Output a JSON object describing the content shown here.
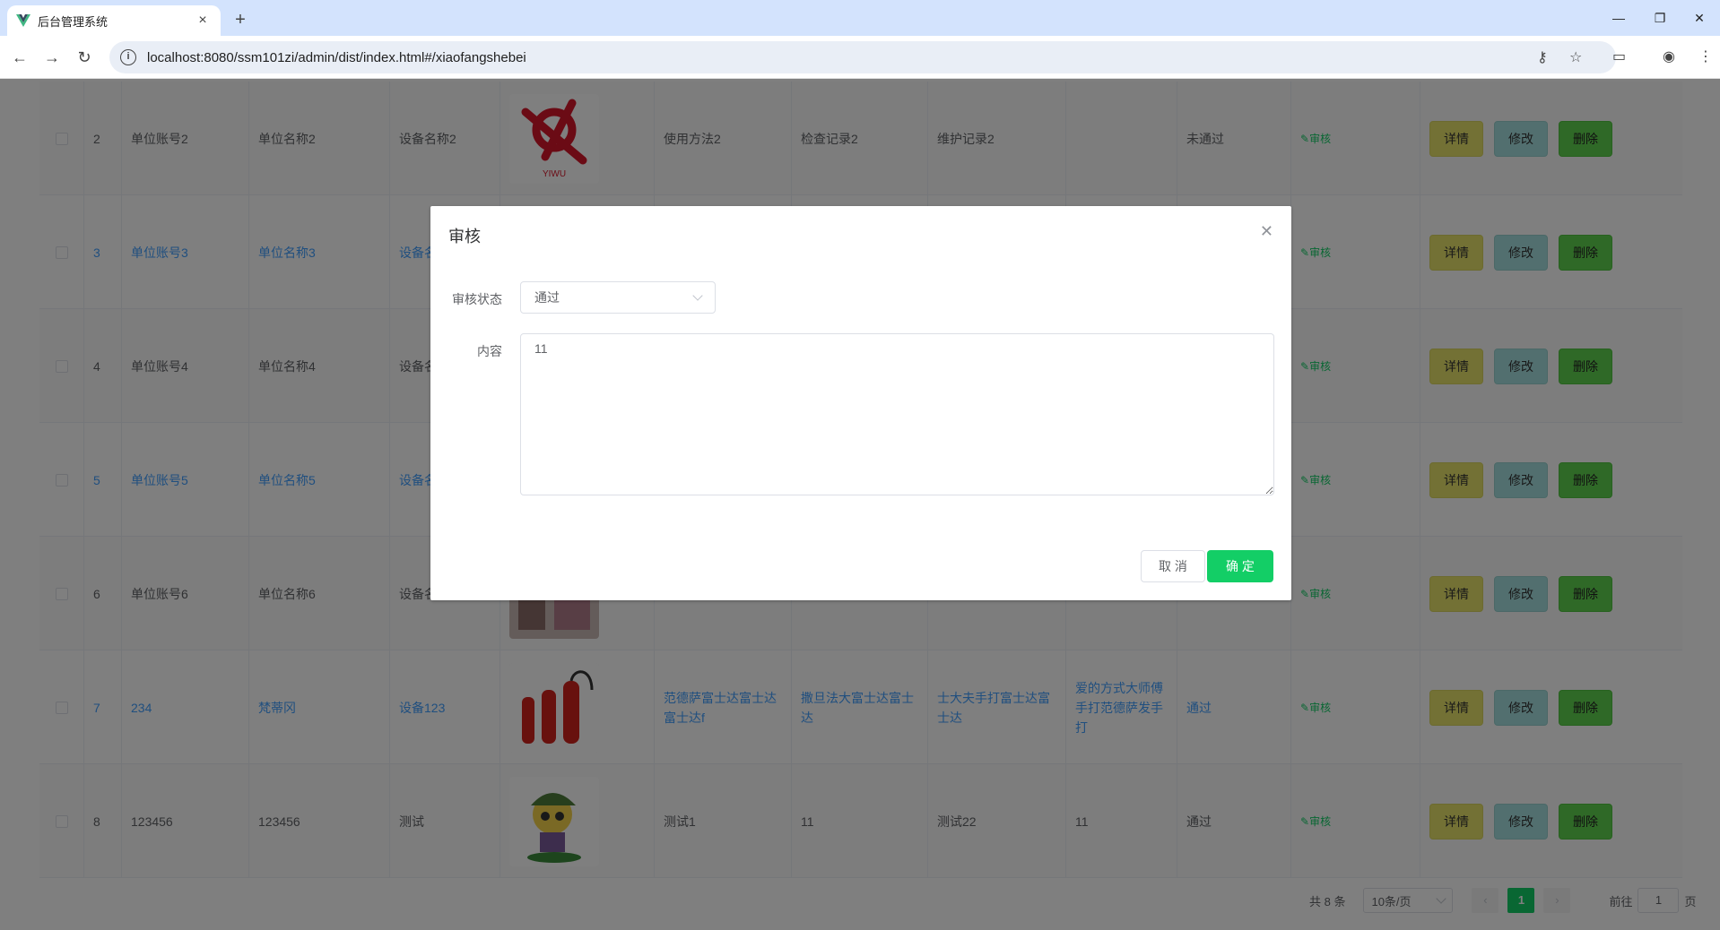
{
  "browser": {
    "tab_title": "后台管理系统",
    "url": "localhost:8080/ssm101zi/admin/dist/index.html#/xiaofangshebei",
    "new_tab": "+",
    "close_tab": "×",
    "back": "←",
    "forward": "→",
    "reload": "↻",
    "minimize": "—",
    "restore": "❐",
    "close_window": "✕"
  },
  "table": {
    "rows": [
      {
        "index": "2",
        "account": "单位账号2",
        "unit": "单位名称2",
        "device": "设备名称2",
        "image": "yiwu-logo",
        "usage": "使用方法2",
        "inspect": "检查记录2",
        "maintain": "维护记录2",
        "extra": "",
        "status": "未通过",
        "link": false
      },
      {
        "index": "3",
        "account": "单位账号3",
        "unit": "单位名称3",
        "device": "设备名",
        "image": "",
        "usage": "",
        "inspect": "",
        "maintain": "",
        "extra": "",
        "status": "",
        "link": true
      },
      {
        "index": "4",
        "account": "单位账号4",
        "unit": "单位名称4",
        "device": "设备名",
        "image": "",
        "usage": "",
        "inspect": "",
        "maintain": "",
        "extra": "",
        "status": "",
        "link": false
      },
      {
        "index": "5",
        "account": "单位账号5",
        "unit": "单位名称5",
        "device": "设备名",
        "image": "",
        "usage": "",
        "inspect": "",
        "maintain": "",
        "extra": "",
        "status": "",
        "link": true
      },
      {
        "index": "6",
        "account": "单位账号6",
        "unit": "单位名称6",
        "device": "设备名",
        "image": "photo",
        "usage": "",
        "inspect": "",
        "maintain": "",
        "extra": "",
        "status": "",
        "link": false
      },
      {
        "index": "7",
        "account": "234",
        "unit": "梵蒂冈",
        "device": "设备123",
        "image": "extinguishers",
        "usage": "范德萨富士达富士达富士达f",
        "inspect": "撒旦法大富士达富士达",
        "maintain": "士大夫手打富士达富士达",
        "extra": "爱的方式大师傅手打范德萨发手打",
        "status": "通过",
        "link": true
      },
      {
        "index": "8",
        "account": "123456",
        "unit": "123456",
        "device": "测试",
        "image": "cartoon",
        "usage": "测试1",
        "inspect": "11",
        "maintain": "测试22",
        "extra": "11",
        "status": "通过",
        "link": false
      }
    ],
    "audit_label": "审核",
    "detail_label": "详情",
    "edit_label": "修改",
    "delete_label": "删除"
  },
  "pagination": {
    "total": "共 8 条",
    "page_size": "10条/页",
    "current_page": "1",
    "goto_label": "前往",
    "goto_value": "1",
    "page_suffix": "页"
  },
  "dialog": {
    "title": "审核",
    "status_label": "审核状态",
    "status_value": "通过",
    "content_label": "内容",
    "content_value": "11",
    "cancel_label": "取 消",
    "ok_label": "确 定"
  },
  "colors": {
    "accent": "#13ce66",
    "link": "#409eff",
    "detail": "#e6e26a",
    "edit": "#a5dfde",
    "delete": "#5fd24e"
  }
}
